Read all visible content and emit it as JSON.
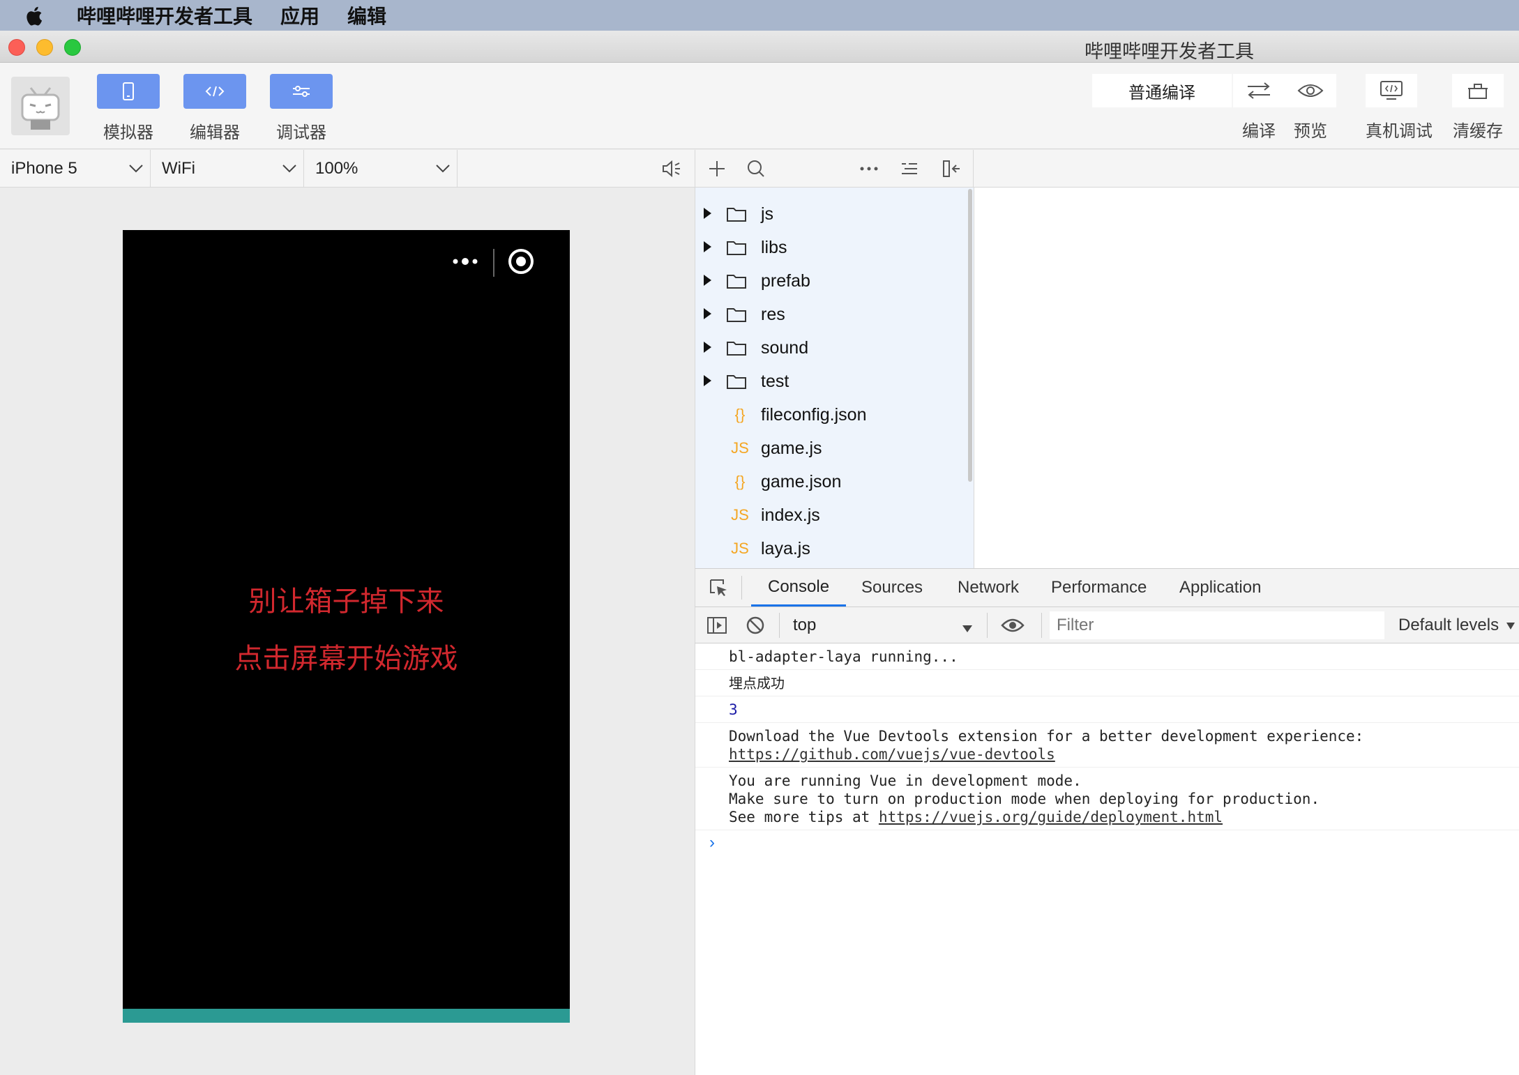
{
  "menubar": {
    "app_name": "哔哩哔哩开发者工具",
    "items": [
      "应用",
      "编辑"
    ]
  },
  "window": {
    "title": "哔哩哔哩开发者工具"
  },
  "toolbar": {
    "left_tools": [
      {
        "label": "模拟器",
        "icon": "phone-icon"
      },
      {
        "label": "编辑器",
        "icon": "code-icon"
      },
      {
        "label": "调试器",
        "icon": "sliders-icon"
      }
    ],
    "compile_mode": "普通编译",
    "right_tools": [
      {
        "label": "编译",
        "icon": "compile-icon"
      },
      {
        "label": "预览",
        "icon": "eye-icon"
      },
      {
        "label": "真机调试",
        "icon": "device-debug-icon"
      },
      {
        "label": "清缓存",
        "icon": "clear-cache-icon"
      }
    ],
    "accent_color": "#6c95ef"
  },
  "simulator": {
    "device": "iPhone 5",
    "network": "WiFi",
    "zoom": "100%",
    "game_lines": [
      "别让箱子掉下来",
      "点击屏幕开始游戏"
    ],
    "text_color": "#d1282e",
    "bottom_bar_color": "#2b9a93"
  },
  "file_tree": [
    {
      "name": "js",
      "type": "folder"
    },
    {
      "name": "libs",
      "type": "folder"
    },
    {
      "name": "prefab",
      "type": "folder"
    },
    {
      "name": "res",
      "type": "folder"
    },
    {
      "name": "sound",
      "type": "folder"
    },
    {
      "name": "test",
      "type": "folder"
    },
    {
      "name": "fileconfig.json",
      "type": "json",
      "badge": "{}"
    },
    {
      "name": "game.js",
      "type": "js",
      "badge": "JS"
    },
    {
      "name": "game.json",
      "type": "json",
      "badge": "{}"
    },
    {
      "name": "index.js",
      "type": "js",
      "badge": "JS"
    },
    {
      "name": "laya.js",
      "type": "js",
      "badge": "JS"
    }
  ],
  "devtools": {
    "tabs": [
      "Console",
      "Sources",
      "Network",
      "Performance",
      "Application"
    ],
    "active_tab": "Console",
    "context": "top",
    "filter_placeholder": "Filter",
    "levels": "Default levels",
    "logs": [
      {
        "lines": [
          "bl-adapter-laya running..."
        ]
      },
      {
        "lines": [
          "埋点成功"
        ]
      },
      {
        "lines": [
          "3"
        ],
        "numeric": true
      },
      {
        "lines": [
          "Download the Vue Devtools extension for a better development experience:"
        ],
        "link": "https://github.com/vuejs/vue-devtools"
      },
      {
        "lines": [
          "You are running Vue in development mode.",
          "Make sure to turn on production mode when deploying for production."
        ],
        "prefix": "See more tips at ",
        "link": "https://vuejs.org/guide/deployment.html"
      }
    ],
    "prompt": "›"
  }
}
